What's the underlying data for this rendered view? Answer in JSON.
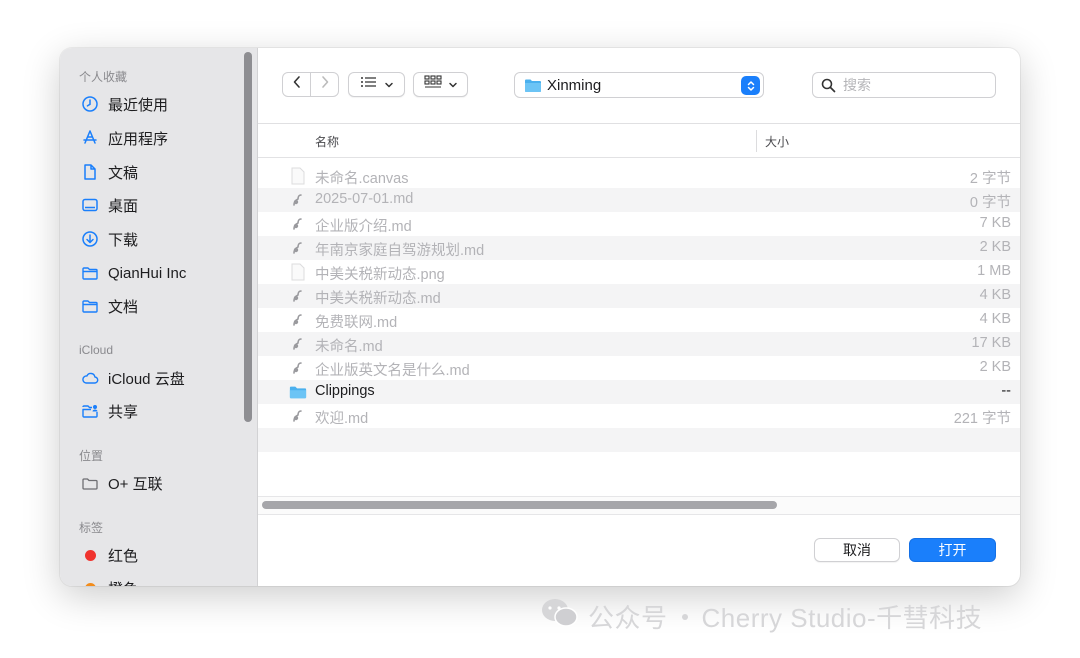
{
  "sidebar": {
    "sections": [
      {
        "title": "个人收藏",
        "items": [
          {
            "label": "最近使用",
            "icon": "clock-icon"
          },
          {
            "label": "应用程序",
            "icon": "apps-icon"
          },
          {
            "label": "文稿",
            "icon": "document-icon"
          },
          {
            "label": "桌面",
            "icon": "desktop-icon"
          },
          {
            "label": "下载",
            "icon": "download-icon"
          },
          {
            "label": "QianHui Inc",
            "icon": "folder-icon"
          },
          {
            "label": "文档",
            "icon": "folder-icon"
          }
        ]
      },
      {
        "title": "iCloud",
        "items": [
          {
            "label": "iCloud 云盘",
            "icon": "cloud-icon"
          },
          {
            "label": "共享",
            "icon": "shared-folder-icon"
          }
        ]
      },
      {
        "title": "位置",
        "items": [
          {
            "label": "O+ 互联",
            "icon": "drive-icon"
          }
        ]
      },
      {
        "title": "标签",
        "items": [
          {
            "label": "红色",
            "color": "#f0332e"
          },
          {
            "label": "橙色",
            "color": "#f28c1c"
          }
        ]
      }
    ]
  },
  "toolbar": {
    "current_folder": "Xinming",
    "search_placeholder": "搜索",
    "view_icons": [
      "list-view-icon",
      "grid-view-icon"
    ]
  },
  "columns": {
    "name": "名称",
    "size": "大小"
  },
  "files": [
    {
      "name": "未命名.canvas",
      "size": "2 字节",
      "type": "blank",
      "enabled": false
    },
    {
      "name": "2025-07-01.md",
      "size": "0 字节",
      "type": "md",
      "enabled": false
    },
    {
      "name": "企业版介绍.md",
      "size": "7 KB",
      "type": "md",
      "enabled": false
    },
    {
      "name": "年南京家庭自驾游规划.md",
      "size": "2 KB",
      "type": "md",
      "enabled": false
    },
    {
      "name": "中美关税新动态.png",
      "size": "1 MB",
      "type": "blank",
      "enabled": false
    },
    {
      "name": "中美关税新动态.md",
      "size": "4 KB",
      "type": "md",
      "enabled": false
    },
    {
      "name": "免费联网.md",
      "size": "4 KB",
      "type": "md",
      "enabled": false
    },
    {
      "name": "未命名.md",
      "size": "17 KB",
      "type": "md",
      "enabled": false
    },
    {
      "name": "企业版英文名是什么.md",
      "size": "2 KB",
      "type": "md",
      "enabled": false
    },
    {
      "name": "Clippings",
      "size": "--",
      "type": "folder",
      "enabled": true
    },
    {
      "name": "欢迎.md",
      "size": "221 字节",
      "type": "md",
      "enabled": false
    }
  ],
  "buttons": {
    "cancel": "取消",
    "open": "打开"
  },
  "watermark": {
    "source": "公众号",
    "text": "Cherry Studio-千彗科技"
  },
  "colors": {
    "accent": "#1a7ffb",
    "sidebar_bg": "#e6e6e8",
    "folder": "#4ab0ee"
  }
}
